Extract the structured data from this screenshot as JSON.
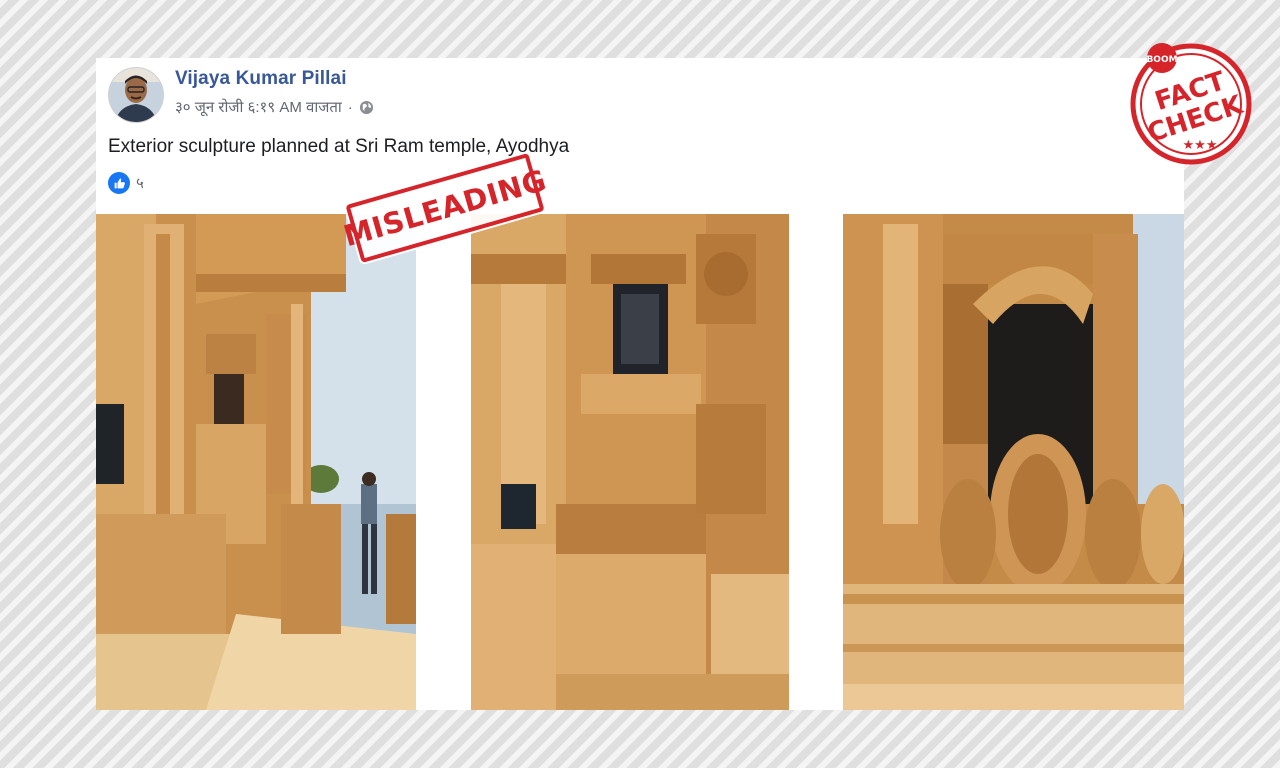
{
  "post": {
    "author_name": "Vijaya Kumar Pillai",
    "timestamp": "३० जून रोजी ६:१९ AM वाजता",
    "separator": "·",
    "audience_icon": "globe-icon",
    "text": "Exterior sculpture planned at Sri Ram temple, Ayodhya",
    "reaction_icon": "like-icon",
    "reaction_count": "५"
  },
  "photos": [
    {
      "name": "temple-photo-left"
    },
    {
      "name": "temple-photo-center"
    },
    {
      "name": "temple-photo-right"
    }
  ],
  "stamps": {
    "misleading": "MISLEADING",
    "fact_check": {
      "brand": "BOOM",
      "line1": "FACT",
      "line2": "CHECK"
    }
  },
  "colors": {
    "author_link": "#385898",
    "like_blue": "#1877f2",
    "stamp_red": "#d6242b",
    "sandstone": "#d9a867"
  }
}
